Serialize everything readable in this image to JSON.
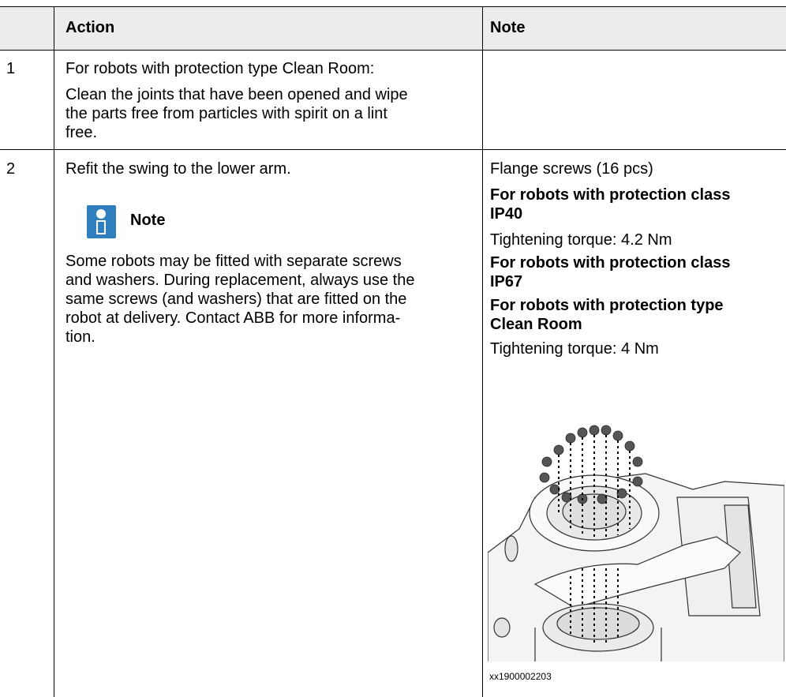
{
  "table": {
    "headers": [
      "",
      "Action",
      "Note"
    ],
    "rows": [
      {
        "num": "1",
        "action_lines": [
          "For robots with protection type Clean Room:",
          "Clean the joints that have been opened and wipe",
          "the parts free from particles with spirit on a lint",
          "free."
        ],
        "note": ""
      },
      {
        "num": "2",
        "action_main": "Refit the swing to the lower arm.",
        "note_label": "Note",
        "note_text_lines": [
          "Some robots may be fitted with separate screws",
          "and washers. During replacement, always use the",
          "same screws (and washers) that are fitted on the",
          "robot at delivery. Contact ABB for more informa-",
          "tion."
        ],
        "note_col": {
          "flange": "Flange screws (16 pcs)",
          "ip40_heading_1": "For robots with protection class",
          "ip40_heading_2": "IP40",
          "ip40_torque": "Tightening torque: 4.2 Nm",
          "ip67_heading_1": "For robots with protection class",
          "ip67_heading_2": "IP67",
          "cr_heading_1": "For robots with protection type",
          "cr_heading_2": "Clean Room",
          "cr_torque": "Tightening torque: 4 Nm",
          "figure_caption": "xx1900002203"
        }
      }
    ]
  },
  "icons": {
    "note": "info-icon"
  },
  "colors": {
    "header_bg": "#ececec",
    "icon_blue": "#2f7fbf"
  }
}
